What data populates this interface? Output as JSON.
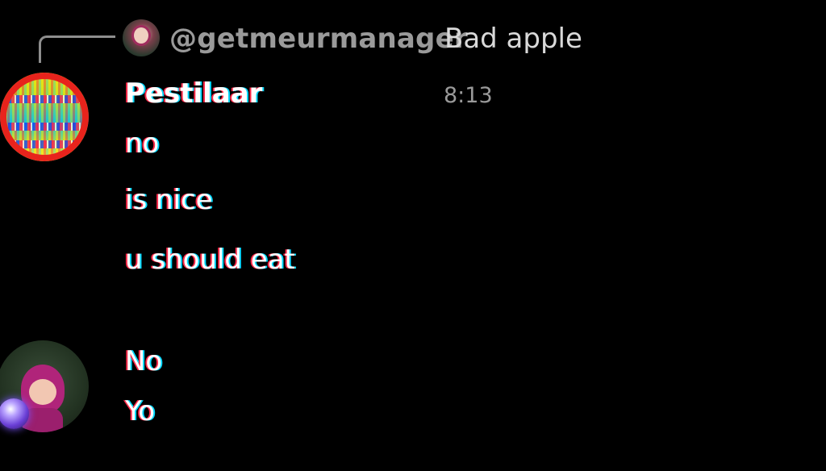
{
  "reply": {
    "username": "@getmeurmanager",
    "preview": "Bad apple"
  },
  "message_group_1": {
    "author": "Pestilaar",
    "timestamp": "8:13",
    "messages": [
      "no",
      "is nice",
      "u should eat"
    ]
  },
  "message_group_2": {
    "messages": [
      "No",
      "Yo"
    ]
  },
  "colors": {
    "background": "#000000",
    "muted_text": "#9a9a9a",
    "primary_text": "#ffffff"
  },
  "icons": {
    "reply_connector": "reply-connector-icon"
  }
}
